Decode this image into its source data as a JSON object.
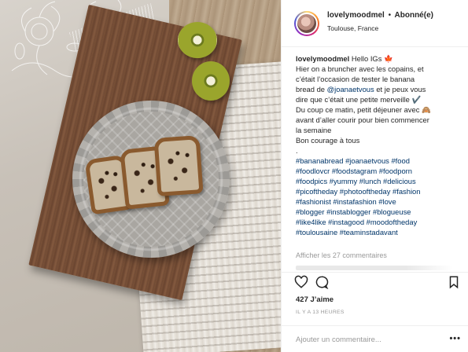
{
  "post": {
    "username": "lovelymoodmel",
    "separator": "•",
    "follow_status": "Abonné(e)",
    "location": "Toulouse, France",
    "caption_lines": [
      "Hello IGs 🍁",
      "Hier on a bruncher avec les copains, et",
      "c’était l’occasion de tester le banana",
      "bread de",
      "@joanaetvous",
      "et je peux vous",
      "dire que c’était une petite merveille ✔️",
      "Du coup ce matin, petit déjeuner avec 🙈",
      "avant d’aller courir pour bien commencer",
      "la semaine",
      "Bon courage à tous",
      "."
    ],
    "hashtags": [
      "#bananabread #joanaetvous #food",
      "#foodlovcr #foodstagram #foodporn",
      "#foodpics #yummy #lunch #delicious",
      "#picoftheday #photooftheday #fashion",
      "#fashionist #instafashion #love",
      "#blogger #instablogger #blogueuse",
      "#like4like #instagood #moodoftheday",
      "#toulousaine #teaminstadavant"
    ],
    "view_comments": "Afficher les 27 commentaires",
    "likes": "427 J’aime",
    "timestamp": "IL Y A 13 HEURES",
    "comment_placeholder": "Ajouter un commentaire...",
    "more_label": "•••"
  },
  "icons": {
    "like": "heart-icon",
    "comment": "comment-bubble-icon",
    "save": "bookmark-icon"
  },
  "colors": {
    "text": "#262626",
    "link": "#003569",
    "muted": "#999999",
    "divider": "#efefef"
  }
}
